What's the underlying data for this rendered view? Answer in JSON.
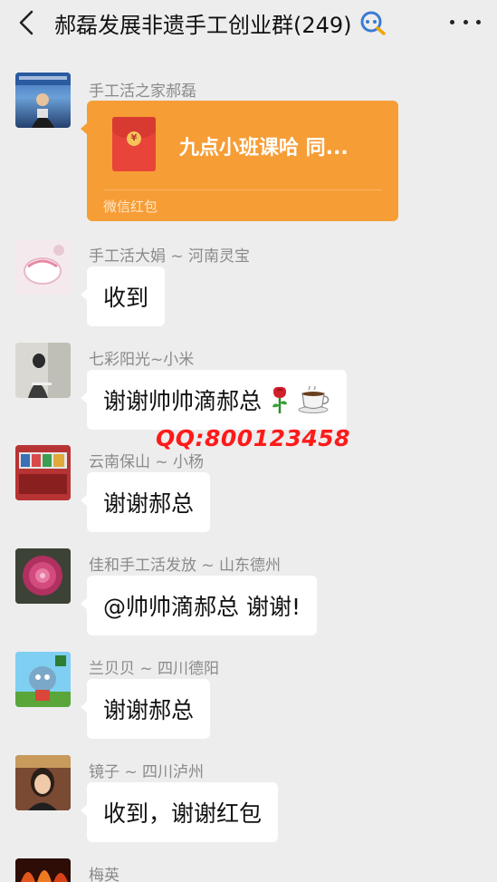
{
  "header": {
    "title": "郝磊发展非遗手工创业群(249)",
    "back_icon": "chevron-left-icon",
    "group_icon": "group-search-icon",
    "more_icon": "more-dots-icon"
  },
  "messages": [
    {
      "sender": "手工活之家郝磊",
      "type": "red_packet",
      "red_packet": {
        "title": "九点小班课哈 同...",
        "footer": "微信红包",
        "color": "#f69d36"
      }
    },
    {
      "sender": "手工活大娟 ~ 河南灵宝",
      "text": "收到"
    },
    {
      "sender": "七彩阳光~小米",
      "text": "谢谢帅帅滴郝总",
      "emojis": [
        "rose-icon",
        "coffee-icon"
      ]
    },
    {
      "sender": "云南保山 ~ 小杨",
      "text": "谢谢郝总"
    },
    {
      "sender": "佳和手工活发放 ~ 山东德州",
      "text": "@帅帅滴郝总  谢谢!"
    },
    {
      "sender": "兰贝贝 ~ 四川德阳",
      "text": "谢谢郝总"
    },
    {
      "sender": "镜子 ~ 四川泸州",
      "text": "收到，谢谢红包"
    },
    {
      "sender": "梅英"
    }
  ],
  "watermark": "QQ:800123458",
  "colors": {
    "background": "#ededed",
    "bubble": "#ffffff",
    "red_packet": "#f69d36",
    "watermark": "#ff1a1a"
  }
}
